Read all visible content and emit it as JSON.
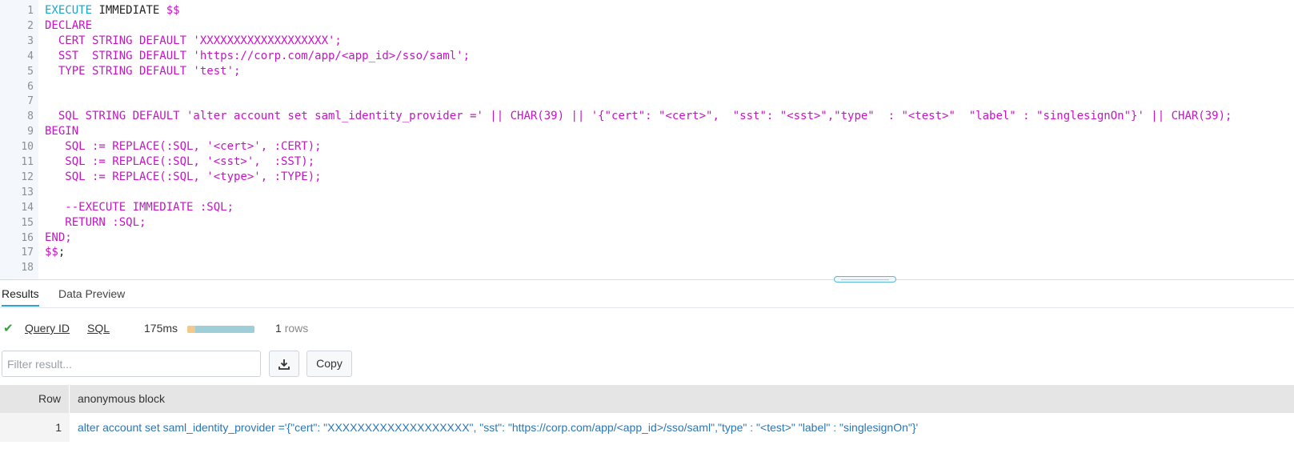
{
  "editor": {
    "lines": [
      {
        "n": "1",
        "parts": [
          {
            "t": "EXECUTE",
            "c": "kw-cyan"
          },
          {
            "t": " IMMEDIATE ",
            "c": "plain"
          },
          {
            "t": "$$",
            "c": "mag"
          }
        ]
      },
      {
        "n": "2",
        "parts": [
          {
            "t": "DECLARE",
            "c": "mag"
          }
        ]
      },
      {
        "n": "3",
        "parts": [
          {
            "t": "  CERT STRING DEFAULT 'XXXXXXXXXXXXXXXXXXX';",
            "c": "mag"
          }
        ]
      },
      {
        "n": "4",
        "parts": [
          {
            "t": "  SST  STRING DEFAULT 'https://corp.com/app/<app_id>/sso/saml';",
            "c": "mag"
          }
        ]
      },
      {
        "n": "5",
        "parts": [
          {
            "t": "  TYPE STRING DEFAULT 'test';",
            "c": "mag"
          }
        ]
      },
      {
        "n": "6",
        "parts": [
          {
            "t": "",
            "c": "mag"
          }
        ]
      },
      {
        "n": "7",
        "parts": [
          {
            "t": "",
            "c": "mag"
          }
        ]
      },
      {
        "n": "8",
        "parts": [
          {
            "t": "  SQL STRING DEFAULT 'alter account set saml_identity_provider =' || CHAR(39) || '{\"cert\": \"<cert>\",  \"sst\": \"<sst>\",\"type\"  : \"<test>\"  \"label\" : \"singlesignOn\"}' || CHAR(39);",
            "c": "mag"
          }
        ]
      },
      {
        "n": "9",
        "parts": [
          {
            "t": "BEGIN",
            "c": "mag"
          }
        ]
      },
      {
        "n": "10",
        "parts": [
          {
            "t": "   SQL := REPLACE(:SQL, '<cert>', :CERT);",
            "c": "mag"
          }
        ]
      },
      {
        "n": "11",
        "parts": [
          {
            "t": "   SQL := REPLACE(:SQL, '<sst>',  :SST);",
            "c": "mag"
          }
        ]
      },
      {
        "n": "12",
        "parts": [
          {
            "t": "   SQL := REPLACE(:SQL, '<type>', :TYPE);",
            "c": "mag"
          }
        ]
      },
      {
        "n": "13",
        "parts": [
          {
            "t": "",
            "c": "mag"
          }
        ]
      },
      {
        "n": "14",
        "parts": [
          {
            "t": "   --EXECUTE IMMEDIATE :SQL;",
            "c": "mag"
          }
        ]
      },
      {
        "n": "15",
        "parts": [
          {
            "t": "   RETURN :SQL;",
            "c": "mag"
          }
        ]
      },
      {
        "n": "16",
        "parts": [
          {
            "t": "END;",
            "c": "mag"
          }
        ]
      },
      {
        "n": "17",
        "parts": [
          {
            "t": "$$",
            "c": "mag"
          },
          {
            "t": ";",
            "c": "plain"
          }
        ]
      },
      {
        "n": "18",
        "parts": [
          {
            "t": "",
            "c": "plain"
          }
        ]
      }
    ]
  },
  "tabs": {
    "results": "Results",
    "data_preview": "Data Preview"
  },
  "status": {
    "query_id": "Query ID",
    "sql": "SQL",
    "duration": "175ms",
    "progress_compile_fraction": 0.12,
    "rows_count": "1",
    "rows_unit": "rows"
  },
  "filter": {
    "placeholder": "Filter result...",
    "download_icon": "download-icon",
    "copy_label": "Copy"
  },
  "table": {
    "headers": [
      "Row",
      "anonymous block"
    ],
    "rows": [
      {
        "num": "1",
        "value": "alter account set saml_identity_provider ='{\"cert\": \"XXXXXXXXXXXXXXXXXXX\", \"sst\": \"https://corp.com/app/<app_id>/sso/saml\",\"type\" : \"<test>\" \"label\" : \"singlesignOn\"}'"
      }
    ]
  },
  "colors": {
    "keyword": "#17a6c7",
    "string": "#c614c6",
    "accent": "#29a3d1",
    "success": "#3c9d45",
    "result_link": "#2a75b8"
  }
}
